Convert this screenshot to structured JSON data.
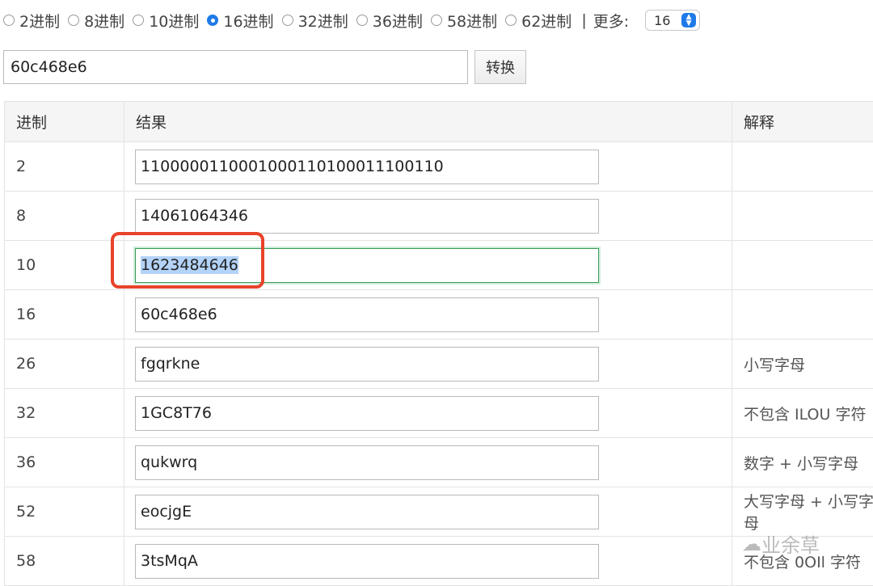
{
  "radio_options": [
    {
      "label": "2进制",
      "checked": false
    },
    {
      "label": "8进制",
      "checked": false
    },
    {
      "label": "10进制",
      "checked": false
    },
    {
      "label": "16进制",
      "checked": true
    },
    {
      "label": "32进制",
      "checked": false
    },
    {
      "label": "36进制",
      "checked": false
    },
    {
      "label": "58进制",
      "checked": false
    },
    {
      "label": "62进制",
      "checked": false
    }
  ],
  "more": {
    "separator": "|",
    "label": "更多:",
    "selected_value": "16"
  },
  "input": {
    "value": "60c468e6"
  },
  "convert_button": "转换",
  "table": {
    "headers": [
      "进制",
      "结果",
      "解释"
    ],
    "rows": [
      {
        "base": "2",
        "result": "1100000110001000110100011100110",
        "note": ""
      },
      {
        "base": "8",
        "result": "14061064346",
        "note": ""
      },
      {
        "base": "10",
        "result": "1623484646",
        "note": ""
      },
      {
        "base": "16",
        "result": "60c468e6",
        "note": ""
      },
      {
        "base": "26",
        "result": "fgqrkne",
        "note": "小写字母"
      },
      {
        "base": "32",
        "result": "1GC8T76",
        "note": "不包含 ILOU 字符"
      },
      {
        "base": "36",
        "result": "qukwrq",
        "note": "数字 + 小写字母"
      },
      {
        "base": "52",
        "result": "eocjgE",
        "note": "大写字母 + 小写字母"
      },
      {
        "base": "58",
        "result": "3tsMqA",
        "note": "不包含 0OIl 字符"
      }
    ]
  },
  "watermark": "业余草",
  "colors": {
    "accent": "#1f7ae8",
    "highlight": "#e8432a",
    "selection": "#b3d3f8"
  }
}
